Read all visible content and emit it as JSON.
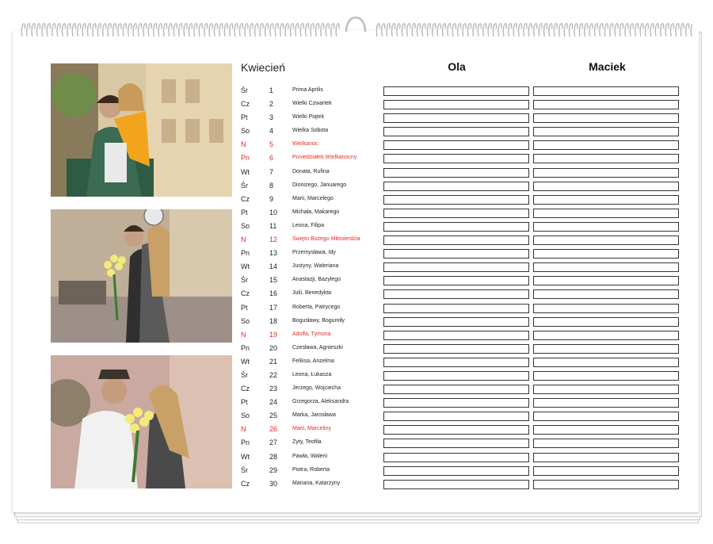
{
  "calendar": {
    "month": "Kwiecień",
    "people": [
      "Ola",
      "Maciek"
    ],
    "holiday_color": "#e52a24",
    "days": [
      {
        "dow": "Śr",
        "day": "1",
        "names": "Prima Aprilis",
        "holiday": false
      },
      {
        "dow": "Cz",
        "day": "2",
        "names": "Wielki Czwartek",
        "holiday": false
      },
      {
        "dow": "Pt",
        "day": "3",
        "names": "Wielki Piątek",
        "holiday": false
      },
      {
        "dow": "So",
        "day": "4",
        "names": "Wielka Sobota",
        "holiday": false
      },
      {
        "dow": "N",
        "day": "5",
        "names": "Wielkanoc",
        "holiday": true
      },
      {
        "dow": "Pn",
        "day": "6",
        "names": "Poniedziałek Wielkanocny",
        "holiday": true
      },
      {
        "dow": "Wt",
        "day": "7",
        "names": "Donata, Rufina",
        "holiday": false
      },
      {
        "dow": "Śr",
        "day": "8",
        "names": "Dionizego, Januarego",
        "holiday": false
      },
      {
        "dow": "Cz",
        "day": "9",
        "names": "Marii, Marcelego",
        "holiday": false
      },
      {
        "dow": "Pt",
        "day": "10",
        "names": "Michała, Makarego",
        "holiday": false
      },
      {
        "dow": "So",
        "day": "11",
        "names": "Leona, Filipa",
        "holiday": false
      },
      {
        "dow": "N",
        "day": "12",
        "names": "Święto Bożego Miłosierdzia",
        "holiday": true
      },
      {
        "dow": "Pn",
        "day": "13",
        "names": "Przemysława, Idy",
        "holiday": false
      },
      {
        "dow": "Wt",
        "day": "14",
        "names": "Justyny, Waleriana",
        "holiday": false
      },
      {
        "dow": "Śr",
        "day": "15",
        "names": "Anastazji, Bazylego",
        "holiday": false
      },
      {
        "dow": "Cz",
        "day": "16",
        "names": "Julii, Benedykta",
        "holiday": false
      },
      {
        "dow": "Pt",
        "day": "17",
        "names": "Roberta, Patrycego",
        "holiday": false
      },
      {
        "dow": "So",
        "day": "18",
        "names": "Bogusławy, Bogumiły",
        "holiday": false
      },
      {
        "dow": "N",
        "day": "19",
        "names": "Adolfa, Tymona",
        "holiday": true
      },
      {
        "dow": "Pn",
        "day": "20",
        "names": "Czesława, Agnieszki",
        "holiday": false
      },
      {
        "dow": "Wt",
        "day": "21",
        "names": "Feliksa, Anzelma",
        "holiday": false
      },
      {
        "dow": "Śr",
        "day": "22",
        "names": "Leona, Łukasza",
        "holiday": false
      },
      {
        "dow": "Cz",
        "day": "23",
        "names": "Jerzego, Wojciecha",
        "holiday": false
      },
      {
        "dow": "Pt",
        "day": "24",
        "names": "Grzegorza, Aleksandra",
        "holiday": false
      },
      {
        "dow": "So",
        "day": "25",
        "names": "Marka, Jarosława",
        "holiday": false
      },
      {
        "dow": "N",
        "day": "26",
        "names": "Marii, Marceliny",
        "holiday": true
      },
      {
        "dow": "Pn",
        "day": "27",
        "names": "Żyty, Teofila",
        "holiday": false
      },
      {
        "dow": "Wt",
        "day": "28",
        "names": "Pawła, Walerii",
        "holiday": false
      },
      {
        "dow": "Śr",
        "day": "29",
        "names": "Piotra, Roberta",
        "holiday": false
      },
      {
        "dow": "Cz",
        "day": "30",
        "names": "Mariana, Katarzyny",
        "holiday": false
      }
    ]
  }
}
